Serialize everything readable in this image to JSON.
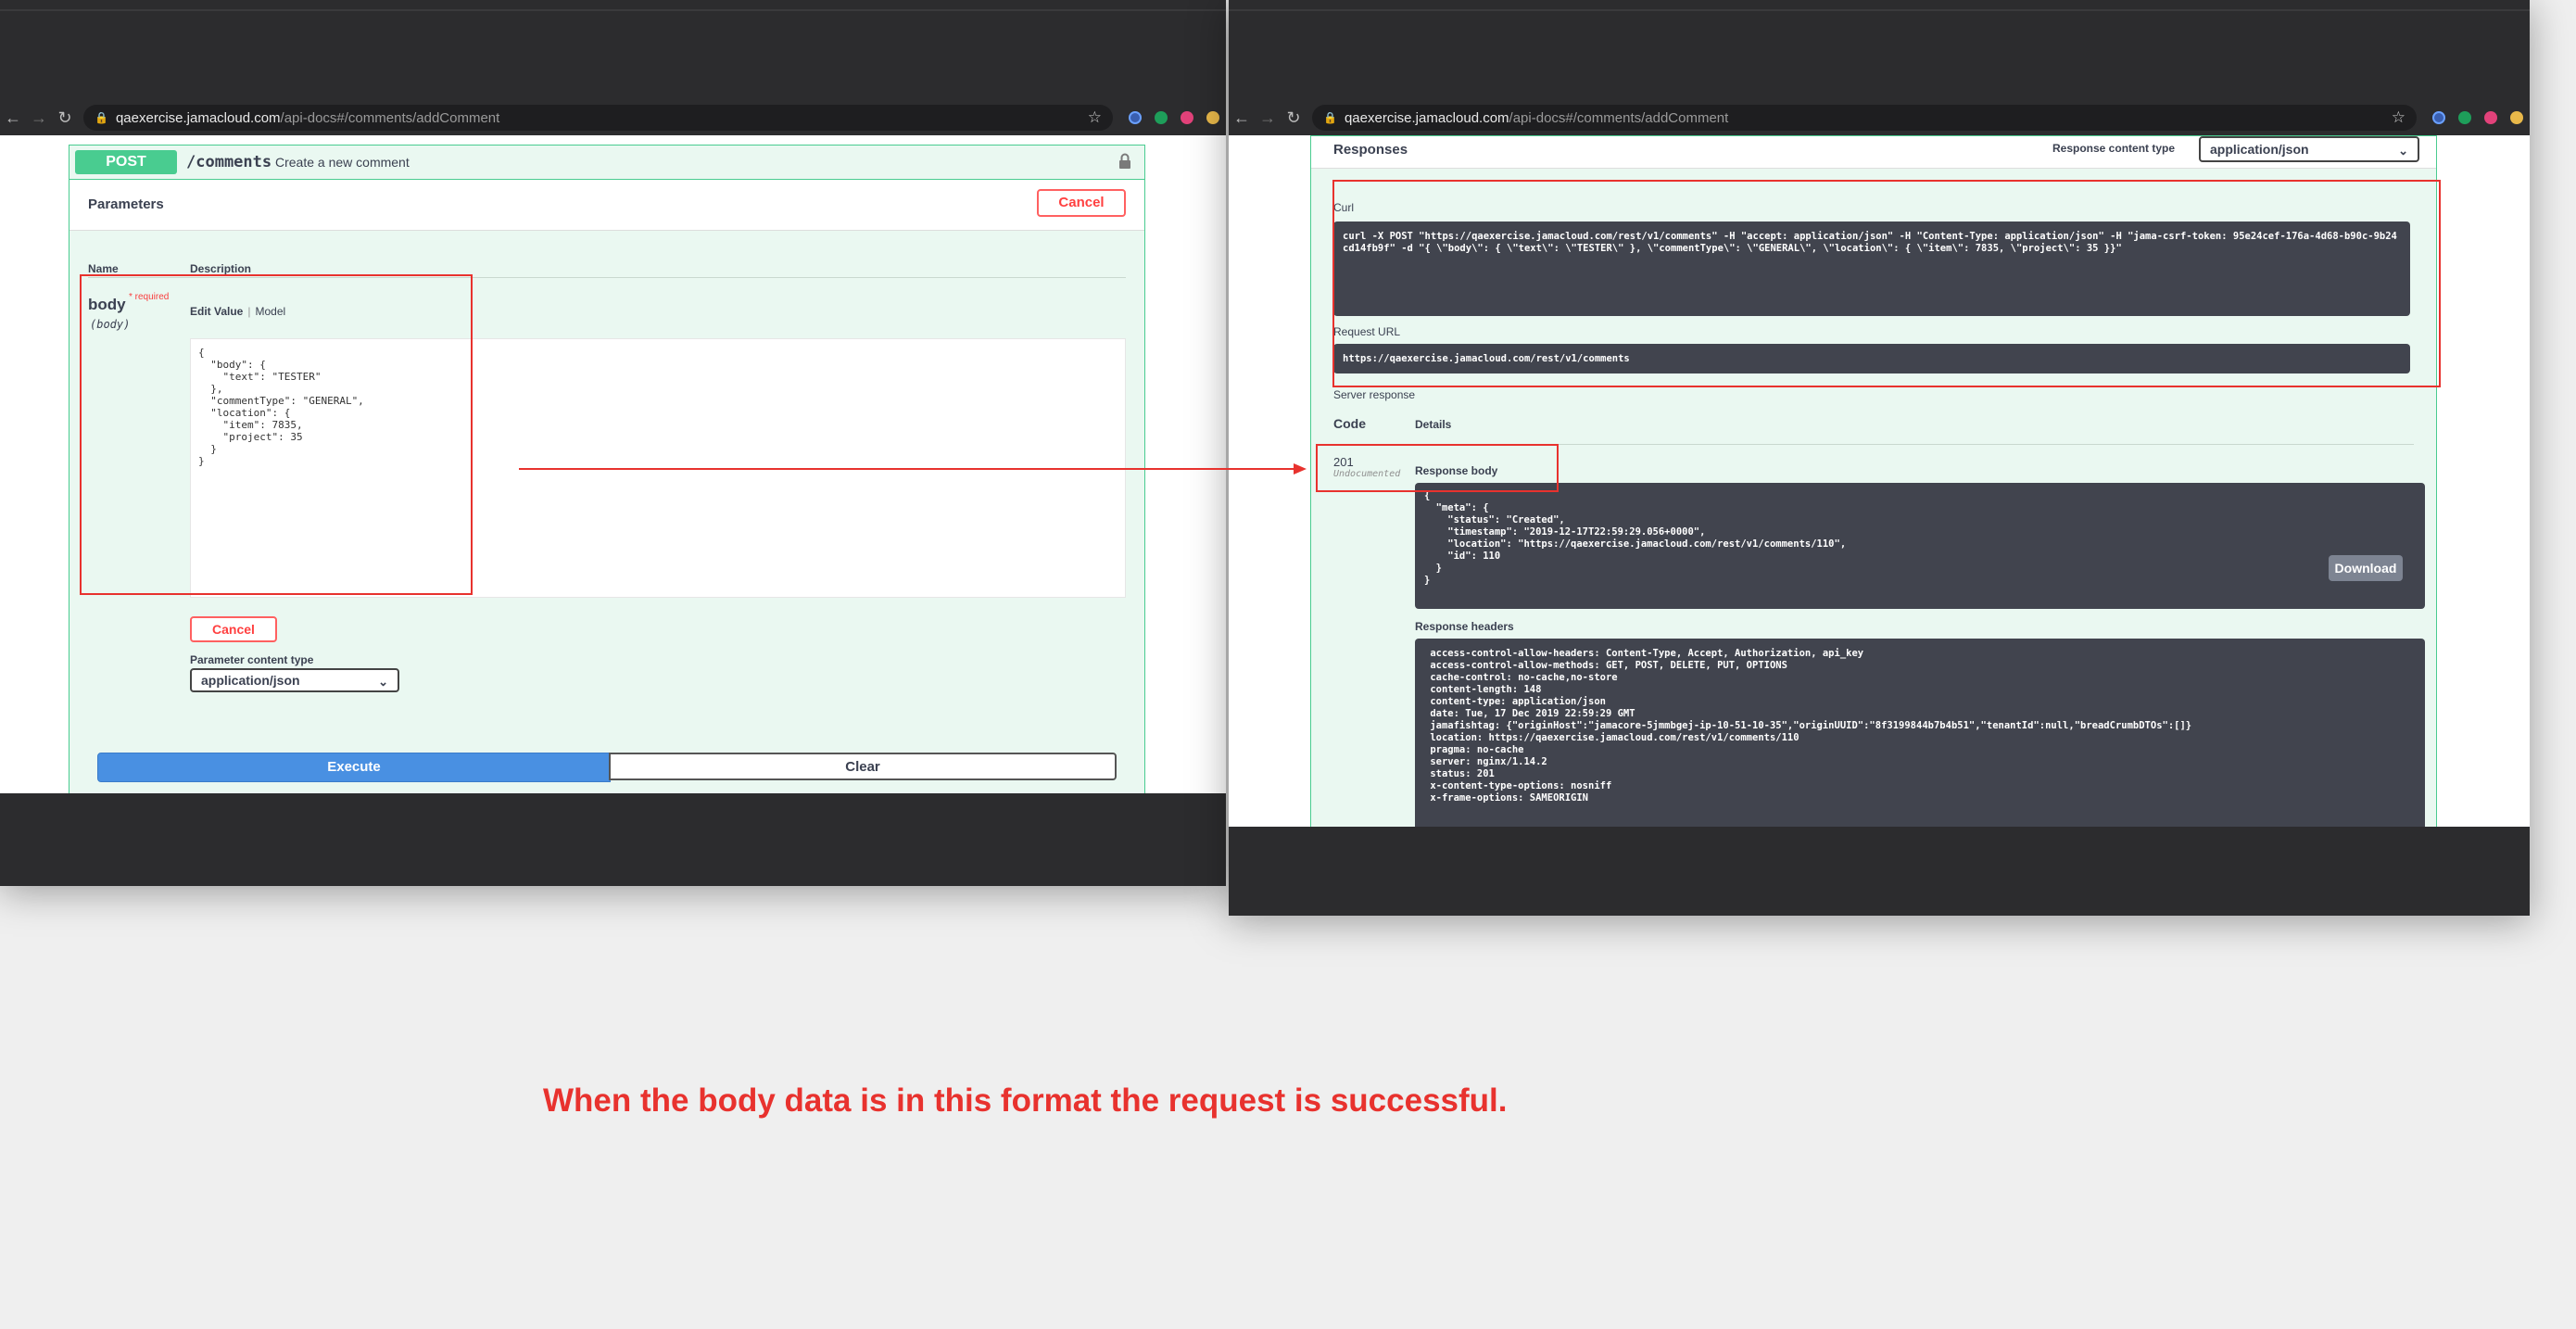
{
  "browser": {
    "url_host": "qaexercise.jamacloud.com",
    "url_path": "/api-docs#/comments/addComment"
  },
  "left": {
    "method": "POST",
    "path": "/comments",
    "summary": "Create a new comment",
    "parameters_title": "Parameters",
    "cancel_label": "Cancel",
    "col_name": "Name",
    "col_description": "Description",
    "param_name": "body",
    "param_required": "* required",
    "param_type": "(body)",
    "tab_edit_value": "Edit Value",
    "tab_model": "Model",
    "body_value": "{\n  \"body\": {\n    \"text\": \"TESTER\"\n  },\n  \"commentType\": \"GENERAL\",\n  \"location\": {\n    \"item\": 7835,\n    \"project\": 35\n  }\n}",
    "cancel_small": "Cancel",
    "content_type_label": "Parameter content type",
    "content_type_value": "application/json",
    "execute_label": "Execute",
    "clear_label": "Clear"
  },
  "right": {
    "responses_title": "Responses",
    "response_content_type_label": "Response content type",
    "response_content_type_value": "application/json",
    "curl_label": "Curl",
    "curl_value": "curl -X POST \"https://qaexercise.jamacloud.com/rest/v1/comments\" -H \"accept: application/json\" -H \"Content-Type: application/json\" -H \"jama-csrf-token: 95e24cef-176a-4d68-b90c-9b24cd14fb9f\" -d \"{ \\\"body\\\": { \\\"text\\\": \\\"TESTER\\\" }, \\\"commentType\\\": \\\"GENERAL\\\", \\\"location\\\": { \\\"item\\\": 7835, \\\"project\\\": 35 }}\"",
    "request_url_label": "Request URL",
    "request_url_value": "https://qaexercise.jamacloud.com/rest/v1/comments",
    "server_response_label": "Server response",
    "code_header": "Code",
    "details_header": "Details",
    "status_code": "201",
    "status_note": "Undocumented",
    "response_body_label": "Response body",
    "response_body": "{\n  \"meta\": {\n    \"status\": \"Created\",\n    \"timestamp\": \"2019-12-17T22:59:29.056+0000\",\n    \"location\": \"https://qaexercise.jamacloud.com/rest/v1/comments/110\",\n    \"id\": 110\n  }\n}",
    "download_label": "Download",
    "response_headers_label": "Response headers",
    "response_headers": " access-control-allow-headers: Content-Type, Accept, Authorization, api_key \n access-control-allow-methods: GET, POST, DELETE, PUT, OPTIONS \n cache-control: no-cache,no-store \n content-length: 148 \n content-type: application/json \n date: Tue, 17 Dec 2019 22:59:29 GMT \n jamafishtag: {\"originHost\":\"jamacore-5jmmbgej-ip-10-51-10-35\",\"originUUID\":\"8f3199844b7b4b51\",\"tenantId\":null,\"breadCrumbDTOs\":[]} \n location: https://qaexercise.jamacloud.com/rest/v1/comments/110 \n pragma: no-cache \n server: nginx/1.14.2 \n status: 201 \n x-content-type-options: nosniff \n x-frame-options: SAMEORIGIN "
  },
  "annotation": {
    "caption": "When the body data is in this format the request is successful.",
    "color": "#e8322e"
  },
  "colors": {
    "post_green": "#49cc90",
    "execute_blue": "#4990e2",
    "code_bg": "#41444e"
  }
}
